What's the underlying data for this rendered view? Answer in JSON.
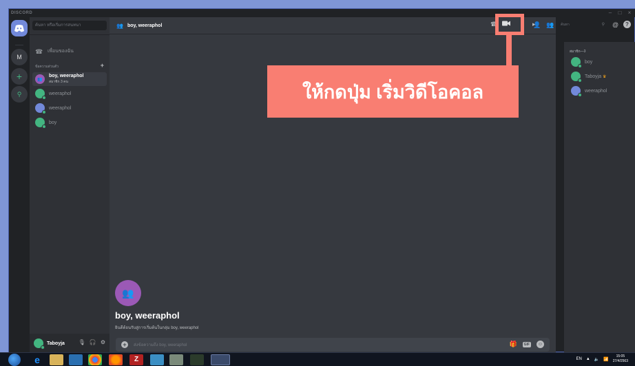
{
  "window": {
    "title": "DISCORD",
    "controls": [
      "–",
      "□",
      "×"
    ]
  },
  "rail": {
    "server_initial": "M",
    "add_label": "+",
    "explore_label": "⚲"
  },
  "sidebar": {
    "search_placeholder": "ค้นหา หรือเริ่มการสนทนา",
    "friends_label": "เพื่อนของฉัน",
    "dm_header": "ข้อความส่วนตัว",
    "dm_add": "+",
    "items": [
      {
        "name": "boy, weeraphol",
        "sub": "สมาชิก 3 คน",
        "color": "#9b59b6",
        "active": true
      },
      {
        "name": "weeraphol",
        "sub": "",
        "color": "#43b581",
        "active": false
      },
      {
        "name": "weeraphol",
        "sub": "",
        "color": "#7289da",
        "active": false
      },
      {
        "name": "boy",
        "sub": "",
        "color": "#43b581",
        "active": false
      }
    ],
    "user": {
      "name": "Taboyja",
      "color": "#43b581"
    }
  },
  "header": {
    "title": "boy, weeraphol",
    "search_placeholder": "ค้นหา"
  },
  "callout": {
    "text": "ให้กดปุ่ม เริ่มวิดีโอคอล",
    "color": "#f97e72"
  },
  "chat": {
    "intro_title": "boy, weeraphol",
    "intro_sub": "ยินดีต้อนรับสู่การเริ่มต้นในกลุ่ม boy, weeraphol",
    "input_placeholder": "ส่งข้อความถึง boy, weeraphol",
    "gif_label": "GIF"
  },
  "members": {
    "header": "สมาชิก—3",
    "items": [
      {
        "name": "boy",
        "owner": false,
        "color": "#43b581"
      },
      {
        "name": "Taboyja",
        "owner": true,
        "color": "#43b581"
      },
      {
        "name": "weeraphol",
        "owner": false,
        "color": "#7289da"
      }
    ]
  },
  "taskbar": {
    "lang": "EN",
    "time": "15:05",
    "date": "27/4/2563"
  }
}
